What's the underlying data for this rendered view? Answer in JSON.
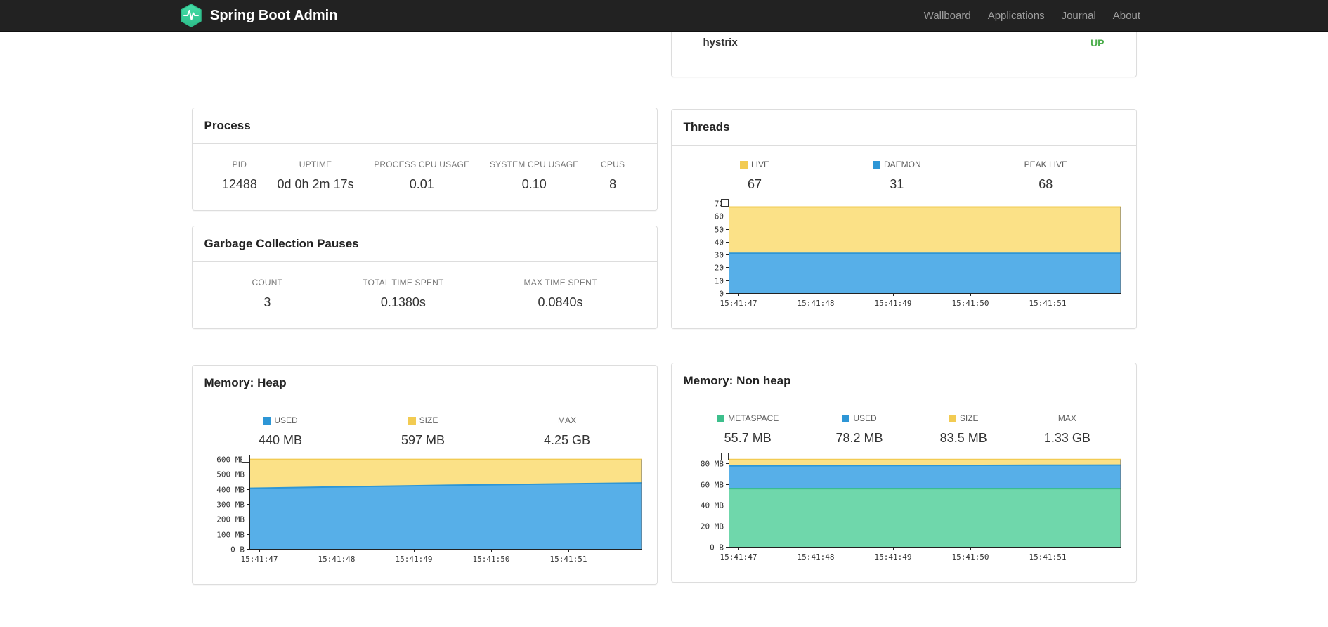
{
  "navbar": {
    "brand": "Spring Boot Admin",
    "items": [
      {
        "label": "Wallboard"
      },
      {
        "label": "Applications"
      },
      {
        "label": "Journal"
      },
      {
        "label": "About"
      }
    ]
  },
  "health": {
    "rows": [
      {
        "name": "hystrix",
        "status": "UP",
        "color": "#4CAE4C"
      }
    ]
  },
  "process": {
    "title": "Process",
    "metrics": [
      {
        "label": "PID",
        "value": "12488"
      },
      {
        "label": "UPTIME",
        "value": "0d 0h 2m 17s"
      },
      {
        "label": "PROCESS CPU USAGE",
        "value": "0.01"
      },
      {
        "label": "SYSTEM CPU USAGE",
        "value": "0.10"
      },
      {
        "label": "CPUS",
        "value": "8"
      }
    ]
  },
  "gc": {
    "title": "Garbage Collection Pauses",
    "metrics": [
      {
        "label": "COUNT",
        "value": "3"
      },
      {
        "label": "TOTAL TIME SPENT",
        "value": "0.1380s"
      },
      {
        "label": "MAX TIME SPENT",
        "value": "0.0840s"
      }
    ]
  },
  "threads": {
    "title": "Threads",
    "legend": [
      {
        "label": "LIVE",
        "value": "67",
        "color": "#F2CB52"
      },
      {
        "label": "DAEMON",
        "value": "31",
        "color": "#2D96D6"
      },
      {
        "label": "PEAK LIVE",
        "value": "68"
      }
    ],
    "chart_data": {
      "type": "area",
      "title": "Threads",
      "x_labels": [
        "15:41:47",
        "15:41:48",
        "15:41:49",
        "15:41:50",
        "15:41:51"
      ],
      "ylim": [
        0,
        70
      ],
      "y_ticks": [
        {
          "value": 0,
          "label": "0"
        },
        {
          "value": 10,
          "label": "10"
        },
        {
          "value": 20,
          "label": "20"
        },
        {
          "value": 30,
          "label": "30"
        },
        {
          "value": 40,
          "label": "40"
        },
        {
          "value": 50,
          "label": "50"
        },
        {
          "value": 60,
          "label": "60"
        },
        {
          "value": 70,
          "label": "70"
        }
      ],
      "series": [
        {
          "name": "LIVE",
          "fill": "#FBE187",
          "line": "#F2CB52",
          "values": [
            67,
            67,
            67,
            67,
            67,
            67
          ]
        },
        {
          "name": "DAEMON",
          "fill": "#57AFE8",
          "line": "#2D96D6",
          "values": [
            31,
            31,
            31,
            31,
            31,
            31
          ]
        }
      ]
    }
  },
  "memory_heap": {
    "title": "Memory: Heap",
    "legend": [
      {
        "label": "USED",
        "value": "440 MB",
        "color": "#2D96D6"
      },
      {
        "label": "SIZE",
        "value": "597 MB",
        "color": "#F2CB52"
      },
      {
        "label": "MAX",
        "value": "4.25 GB"
      }
    ],
    "chart_data": {
      "type": "area",
      "title": "Memory: Heap",
      "x_labels": [
        "15:41:47",
        "15:41:48",
        "15:41:49",
        "15:41:50",
        "15:41:51"
      ],
      "ylim": [
        0,
        600
      ],
      "y_ticks": [
        {
          "value": 0,
          "label": "0 B"
        },
        {
          "value": 100,
          "label": "100 MB"
        },
        {
          "value": 200,
          "label": "200 MB"
        },
        {
          "value": 300,
          "label": "300 MB"
        },
        {
          "value": 400,
          "label": "400 MB"
        },
        {
          "value": 500,
          "label": "500 MB"
        },
        {
          "value": 600,
          "label": "600 MB"
        }
      ],
      "series": [
        {
          "name": "SIZE",
          "fill": "#FBE187",
          "line": "#F2CB52",
          "values": [
            597,
            597,
            597,
            597,
            597,
            597
          ]
        },
        {
          "name": "USED",
          "fill": "#57AFE8",
          "line": "#2D96D6",
          "values": [
            405,
            413,
            421,
            428,
            434,
            440
          ]
        }
      ]
    }
  },
  "memory_nonheap": {
    "title": "Memory: Non heap",
    "legend": [
      {
        "label": "METASPACE",
        "value": "55.7 MB",
        "color": "#3DBF8C"
      },
      {
        "label": "USED",
        "value": "78.2 MB",
        "color": "#2D96D6"
      },
      {
        "label": "SIZE",
        "value": "83.5 MB",
        "color": "#F2CB52"
      },
      {
        "label": "MAX",
        "value": "1.33 GB"
      }
    ],
    "chart_data": {
      "type": "area",
      "title": "Memory: Non heap",
      "x_labels": [
        "15:41:47",
        "15:41:48",
        "15:41:49",
        "15:41:50",
        "15:41:51"
      ],
      "ylim": [
        0,
        86
      ],
      "y_ticks": [
        {
          "value": 0,
          "label": "0 B"
        },
        {
          "value": 20,
          "label": "20 MB"
        },
        {
          "value": 40,
          "label": "40 MB"
        },
        {
          "value": 60,
          "label": "60 MB"
        },
        {
          "value": 80,
          "label": "80 MB"
        }
      ],
      "series": [
        {
          "name": "SIZE",
          "fill": "#FBE187",
          "line": "#F2CB52",
          "values": [
            83.5,
            83.5,
            83.5,
            83.5,
            83.5,
            83.5
          ]
        },
        {
          "name": "USED",
          "fill": "#57AFE8",
          "line": "#2D96D6",
          "values": [
            77.4,
            77.6,
            77.8,
            77.9,
            78.1,
            78.2
          ]
        },
        {
          "name": "METASPACE",
          "fill": "#6FD7AB",
          "line": "#36BD86",
          "values": [
            55.7,
            55.7,
            55.7,
            55.7,
            55.7,
            55.7
          ]
        }
      ]
    }
  },
  "colors": {
    "navbar_bg": "#222222",
    "logo_teal": "#3ED49E",
    "status_up": "#4CAE4C"
  }
}
